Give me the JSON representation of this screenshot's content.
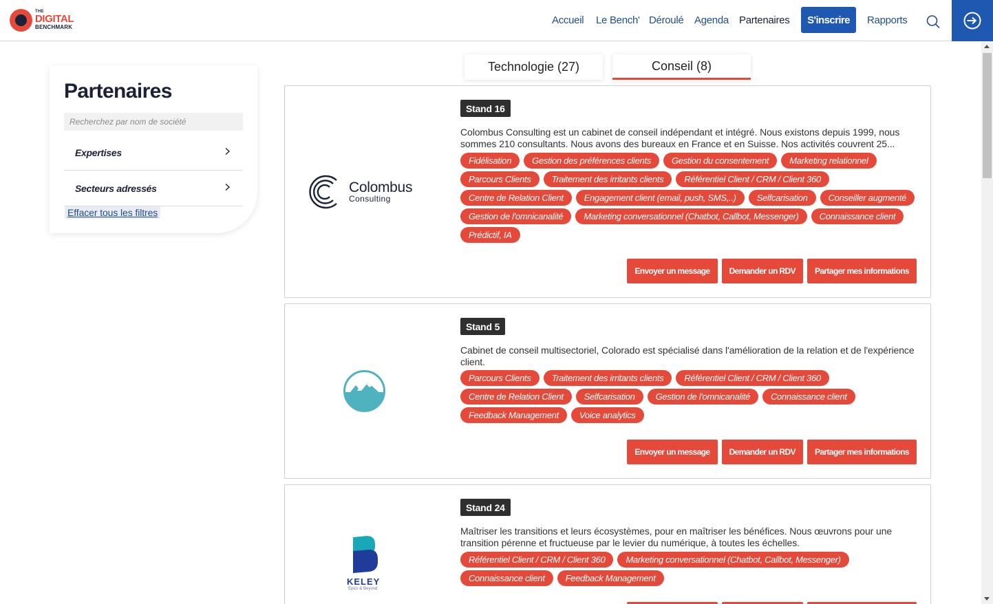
{
  "header": {
    "logo": {
      "line1": "THE",
      "line2_part1": "DIGITAL",
      "line3": "BENCHMARK"
    },
    "nav": [
      {
        "label": "Accueil"
      },
      {
        "label": "Le Bench'"
      },
      {
        "label": "Déroulé"
      },
      {
        "label": "Agenda"
      },
      {
        "label": "Partenaires"
      }
    ],
    "cta_label": "S'inscrire",
    "reports_label": "Rapports",
    "search_icon": "search-icon",
    "login_icon": "sign-in-icon"
  },
  "sidebar": {
    "title": "Partenaires",
    "search_placeholder": "Recherchez par nom de société",
    "filters": [
      {
        "label": "Expertises"
      },
      {
        "label": "Secteurs adressés"
      }
    ],
    "clear_label": "Effacer tous les filtres"
  },
  "tabs": [
    {
      "label": "Technologie (27)",
      "active": false
    },
    {
      "label": "Conseil (8)",
      "active": true
    }
  ],
  "partners": [
    {
      "logo_name": "Colombus",
      "logo_sub": "Consulting",
      "stand": "Stand 16",
      "description": "Colombus Consulting est un cabinet de conseil indépendant et intégré. Nous existons depuis 1999, nous sommes 210 consultants. Nous avons des bureaux en France et en Suisse. Nos activités couvrent 25...",
      "tags": [
        "Fidélisation",
        "Gestion des préférences clients",
        "Gestion du consentement",
        "Marketing relationnel",
        "Parcours Clients",
        "Traitement des irritants clients",
        "Référentiel Client / CRM / Client 360",
        "Centre de Relation Client",
        "Engagement client (email, push, SMS,..)",
        "Selfcarisation",
        "Conseiller augmenté",
        "Gestion de l'omnicanalité",
        "Marketing conversationnel (Chatbot, Callbot, Messenger)",
        "Connaissance client",
        "Prédictif, IA"
      ]
    },
    {
      "logo_name": "",
      "logo_sub": "",
      "stand": "Stand 5",
      "description": "Cabinet de conseil multisectoriel, Colorado est spécialisé dans l'amélioration de la relation et de l'expérience client.",
      "tags": [
        "Parcours Clients",
        "Traitement des irritants clients",
        "Référentiel Client / CRM / Client 360",
        "Centre de Relation Client",
        "Selfcarisation",
        "Gestion de l'omnicanalité",
        "Connaissance client",
        "Feedback Management",
        "Voice analytics"
      ]
    },
    {
      "logo_name": "KELEY",
      "logo_sub": "Epics & Beyond",
      "stand": "Stand 24",
      "description": "Maîtriser les transitions et leurs écosystèmes, pour en maîtriser les bénéfices.  Nous œuvrons pour une transition pérenne et fructueuse par le levier du numérique, à toutes les échelles.",
      "tags": [
        "Référentiel Client / CRM / Client 360",
        "Marketing conversationnel (Chatbot, Callbot, Messenger)",
        "Connaissance client",
        "Feedback Management"
      ]
    }
  ],
  "actions": {
    "message": "Envoyer un message",
    "rdv": "Demander un RDV",
    "share": "Partager mes informations"
  },
  "colors": {
    "accent": "#e5493a",
    "primary": "#1f58b0",
    "navy": "#1a2238"
  }
}
